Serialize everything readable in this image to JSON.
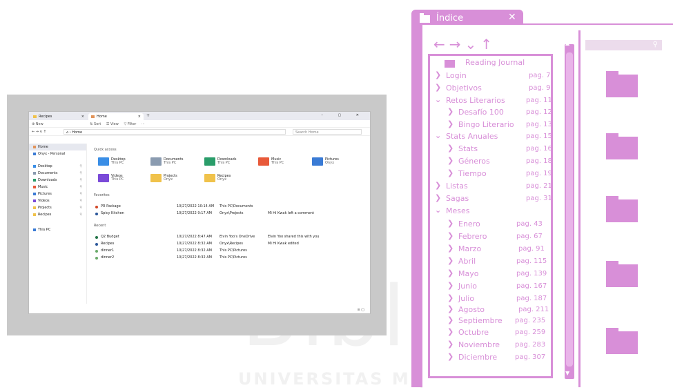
{
  "explorer": {
    "tabs": [
      {
        "label": "Recipes",
        "close": "×"
      },
      {
        "label": "Home",
        "close": "×"
      }
    ],
    "new_tab": "+",
    "window_controls": "– ▢ ✕",
    "toolbar": {
      "new": "⊕ New",
      "sort": "⇅ Sort",
      "view": "☰ View",
      "filter": "▽ Filter",
      "more": "···"
    },
    "address": {
      "nav": "← → ∨ ↑",
      "path": "⌂ › Home",
      "search_placeholder": "Search Home"
    },
    "nav_items": [
      {
        "label": "Home",
        "color": "#e2945a"
      },
      {
        "label": "Onyx - Personal",
        "color": "#3a7bd5"
      },
      {
        "label": "Desktop",
        "color": "#3a8ee6"
      },
      {
        "label": "Documents",
        "color": "#8a9bb0"
      },
      {
        "label": "Downloads",
        "color": "#2a9d6a"
      },
      {
        "label": "Music",
        "color": "#e85a3a"
      },
      {
        "label": "Pictures",
        "color": "#3a7bd5"
      },
      {
        "label": "Videos",
        "color": "#7a4ad8"
      },
      {
        "label": "Projects",
        "color": "#f0c24b"
      },
      {
        "label": "Recipes",
        "color": "#f0c24b"
      },
      {
        "label": "This PC",
        "color": "#3a7bd5"
      }
    ],
    "quick_access_title": "Quick access",
    "quick_access": [
      {
        "name": "Desktop",
        "sub": "This PC",
        "color": "#3a8ee6"
      },
      {
        "name": "Documents",
        "sub": "This PC",
        "color": "#8a9bb0"
      },
      {
        "name": "Downloads",
        "sub": "This PC",
        "color": "#2a9d6a"
      },
      {
        "name": "Music",
        "sub": "This PC",
        "color": "#e85a3a"
      },
      {
        "name": "Pictures",
        "sub": "Onyx",
        "color": "#3a7bd5"
      },
      {
        "name": "Videos",
        "sub": "This PC",
        "color": "#7a4ad8"
      },
      {
        "name": "Projects",
        "sub": "Onyx",
        "color": "#f0c24b"
      },
      {
        "name": "Recipes",
        "sub": "Onyx",
        "color": "#f0c24b"
      }
    ],
    "favorites_title": "Favorites",
    "favorites": [
      {
        "name": "PR Package",
        "date": "10/27/2022 10:14 AM",
        "location": "This PC\\Documents",
        "activity": ""
      },
      {
        "name": "Spicy Kitchen",
        "date": "10/27/2022 9:17 AM",
        "location": "Onyx\\Projects",
        "activity": "Mi Hi Kwak left a comment"
      }
    ],
    "recent_title": "Recent",
    "recent": [
      {
        "name": "Q2 Budget",
        "date": "10/27/2022 8:47 AM",
        "location": "Elvin Yoo's OneDrive",
        "activity": "Elvin Yoo shared this with you"
      },
      {
        "name": "Recipes",
        "date": "10/27/2022 8:32 AM",
        "location": "Onyx\\Recipes",
        "activity": "Mi Hi Kwak edited"
      },
      {
        "name": "dinner1",
        "date": "10/27/2022 8:32 AM",
        "location": "This PC\\Pictures",
        "activity": ""
      },
      {
        "name": "dinner2",
        "date": "10/27/2022 8:32 AM",
        "location": "This PC\\Pictures",
        "activity": ""
      }
    ],
    "status_icons": "≡ ▢"
  },
  "toc_window": {
    "title": "Índice",
    "close": "✕",
    "toolbar_arrows": "←→⌄↑",
    "search_icon": "⚲",
    "accent": "#d88fd8",
    "root": "Reading Journal",
    "items": [
      {
        "label": "Login",
        "page": "pag. 7",
        "chev": "❯"
      },
      {
        "label": "Objetivos",
        "page": "pag. 9",
        "chev": "❯"
      },
      {
        "label": "Retos Literarios",
        "page": "pag. 11",
        "chev": "⌄"
      },
      {
        "label": "Desafío 100",
        "page": "pag. 12",
        "chev": "❯"
      },
      {
        "label": "Bingo Literario",
        "page": "pag. 13",
        "chev": "❯"
      },
      {
        "label": "Stats Anuales",
        "page": "pag. 15",
        "chev": "⌄"
      },
      {
        "label": "Stats",
        "page": "pag. 16",
        "chev": "❯"
      },
      {
        "label": "Géneros",
        "page": "pag. 18",
        "chev": "❯"
      },
      {
        "label": "Tiempo",
        "page": "pag. 19",
        "chev": "❯"
      },
      {
        "label": "Listas",
        "page": "pag. 21",
        "chev": "❯"
      },
      {
        "label": "Sagas",
        "page": "pag. 31",
        "chev": "❯"
      },
      {
        "label": "Meses",
        "page": "",
        "chev": "⌄"
      },
      {
        "label": "Enero",
        "page": "pag. 43",
        "chev": "❯"
      },
      {
        "label": "Febrero",
        "page": "pag. 67",
        "chev": "❯"
      },
      {
        "label": "Marzo",
        "page": "pag. 91",
        "chev": "❯"
      },
      {
        "label": "Abril",
        "page": "pag. 115",
        "chev": "❯"
      },
      {
        "label": "Mayo",
        "page": "pag. 139",
        "chev": "❯"
      },
      {
        "label": "Junio",
        "page": "pag. 167",
        "chev": "❯"
      },
      {
        "label": "Julio",
        "page": "pag. 187",
        "chev": "❯"
      },
      {
        "label": "Agosto",
        "page": "pag. 211",
        "chev": "❯"
      },
      {
        "label": "Septiembre",
        "page": "pag. 235",
        "chev": "❯"
      },
      {
        "label": "Octubre",
        "page": "pag. 259",
        "chev": "❯"
      },
      {
        "label": "Noviembre",
        "page": "pag. 283",
        "chev": "❯"
      },
      {
        "label": "Diciembre",
        "page": "pag. 307",
        "chev": "❯"
      }
    ],
    "scroll_up": "▲",
    "scroll_down": "▼"
  },
  "watermark": {
    "text": "Biblioteca",
    "subtext": "UNIVERSITAS Miguel Hernández"
  }
}
